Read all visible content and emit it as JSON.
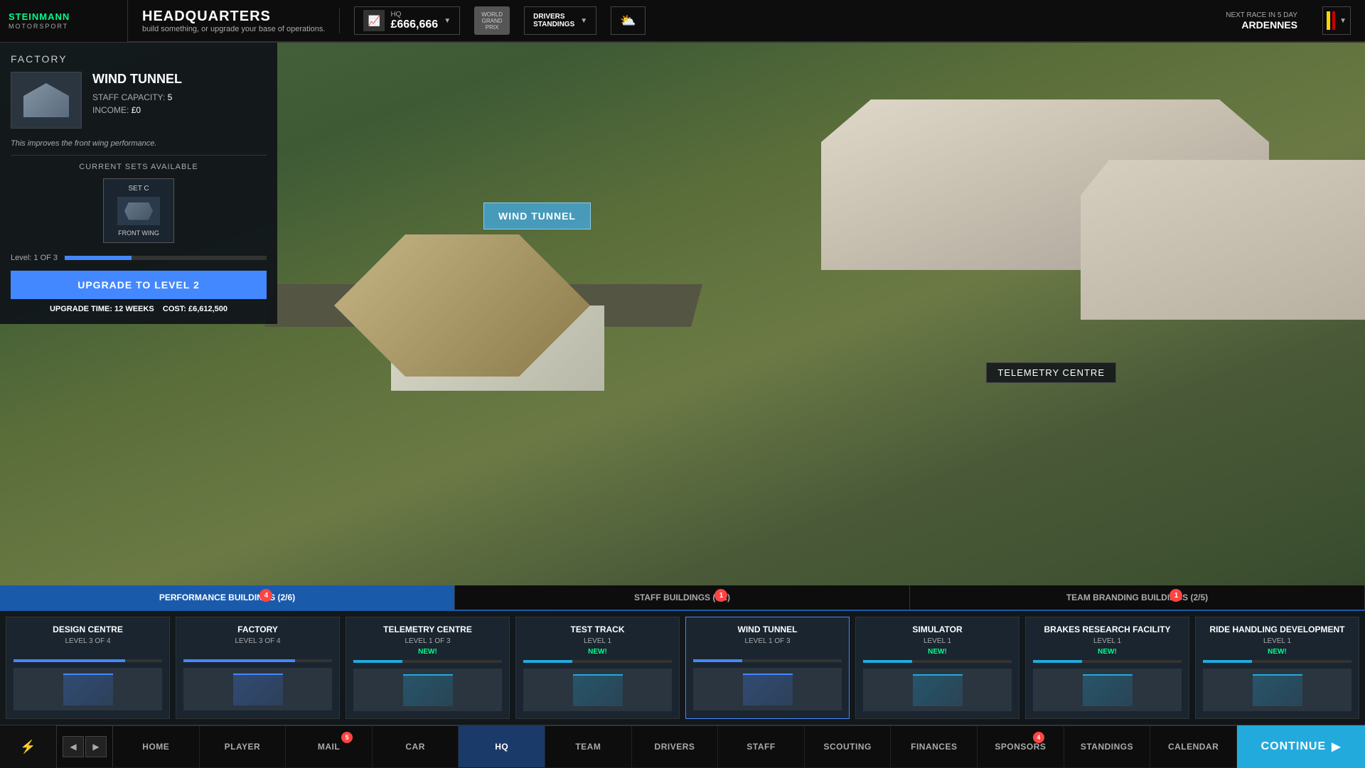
{
  "header": {
    "logo_main": "STEINMANN",
    "logo_sub": "MOTORSPORT",
    "page_title": "HEADQUARTERS",
    "page_subtitle": "build something, or upgrade your base of operations.",
    "hq_label": "HQ",
    "hq_money": "£666,666",
    "world_label": "WORLD\nGRAND PRIX",
    "drivers_standings": "DRIVERS\nSTANDINGS",
    "next_race_label": "NEXT RACE IN 5 DAY",
    "next_race_name": "ARDENNES"
  },
  "left_panel": {
    "factory_label": "FACTORY",
    "building_name": "WIND TUNNEL",
    "staff_capacity_label": "STAFF CAPACITY:",
    "staff_capacity_value": "5",
    "income_label": "INCOME:",
    "income_value": "£0",
    "description": "This improves the front wing performance.",
    "current_sets_label": "CURRENT SETS AVAILABLE",
    "set_c_label": "SET C",
    "set_c_item": "FRONT WING",
    "level_label": "Level:",
    "level_value": "1 OF 3",
    "upgrade_btn": "UPGRADE TO LEVEL 2",
    "upgrade_time_label": "UPGRADE TIME:",
    "upgrade_time_value": "12 WEEKS",
    "cost_label": "COST:",
    "cost_value": "£6,612,500",
    "level_fill_pct": 33
  },
  "map_tooltip": "WIND TUNNEL",
  "telemetry_label": "TELEMETRY CENTRE",
  "buildings_tabs": [
    {
      "label": "PERFORMANCE BUILDINGS (2/6)",
      "active": true,
      "badge": 4
    },
    {
      "label": "STAFF BUILDINGS (1/2)",
      "active": false,
      "badge": 1
    },
    {
      "label": "TEAM BRANDING BUILDINGS (2/5)",
      "active": false,
      "badge": 1
    }
  ],
  "buildings": [
    {
      "name": "Design Centre",
      "level": "LEVEL 3 OF 4",
      "new": false,
      "fill": 75
    },
    {
      "name": "Factory",
      "level": "LEVEL 3 OF 4",
      "new": false,
      "fill": 75
    },
    {
      "name": "Telemetry Centre",
      "level": "LEVEL 1 OF 3",
      "new": true,
      "fill": 33
    },
    {
      "name": "Test Track",
      "level": "LEVEL 1",
      "new": true,
      "fill": 33
    },
    {
      "name": "Wind Tunnel",
      "level": "LEVEL 1 OF 3",
      "new": false,
      "fill": 33
    },
    {
      "name": "Simulator",
      "level": "LEVEL 1",
      "new": true,
      "fill": 33
    },
    {
      "name": "Brakes Research Facility",
      "level": "LEVEL 1",
      "new": true,
      "fill": 33
    },
    {
      "name": "Ride Handling Development",
      "level": "LEVEL 1",
      "new": true,
      "fill": 33
    }
  ],
  "nav": {
    "items": [
      {
        "label": "Home",
        "active": false,
        "badge": 0
      },
      {
        "label": "Player",
        "active": false,
        "badge": 0
      },
      {
        "label": "Mail",
        "active": false,
        "badge": 5
      },
      {
        "label": "Car",
        "active": false,
        "badge": 0
      },
      {
        "label": "HQ",
        "active": true,
        "badge": 0
      },
      {
        "label": "Team",
        "active": false,
        "badge": 0
      },
      {
        "label": "Drivers",
        "active": false,
        "badge": 0
      },
      {
        "label": "Staff",
        "active": false,
        "badge": 0
      },
      {
        "label": "Scouting",
        "active": false,
        "badge": 0
      },
      {
        "label": "Finances",
        "active": false,
        "badge": 0
      },
      {
        "label": "Sponsors",
        "active": false,
        "badge": 4
      },
      {
        "label": "Standings",
        "active": false,
        "badge": 0
      },
      {
        "label": "Calendar",
        "active": false,
        "badge": 0
      }
    ],
    "continue_label": "Continue"
  }
}
